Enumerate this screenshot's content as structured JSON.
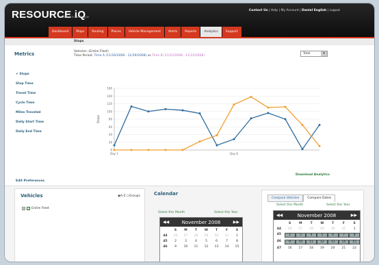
{
  "brand": {
    "logo": "RESOURCE iQ",
    "tagline": "CONNECTIONS BY jayte"
  },
  "toplinks": {
    "contact": "Contact Us",
    "help": "Help",
    "account": "My Account",
    "user": "Daniel English",
    "logout": "Logout"
  },
  "nav": [
    "Dashboard",
    "Maps",
    "Routing",
    "Places",
    "Vehicle Management",
    "Alerts",
    "Reports",
    "Analytics",
    "Support"
  ],
  "nav_active": "Analytics",
  "section_title": "Stops",
  "metrics": {
    "title": "Metrics",
    "items": [
      "+ Stops",
      "Stop Time",
      "Travel Time",
      "Cycle Time",
      "Miles Traveled",
      "Daily Start Time",
      "Daily End Time"
    ]
  },
  "vehicles_line": "Vehicles: (Entire Fleet)",
  "period": {
    "label": "Time Period:",
    "a": "Time A (11/16/2008 - 11/29/2008)",
    "sep": "vs",
    "b": "Time B (11/15/2008 - 11/15/2008)"
  },
  "select": {
    "value": "Total"
  },
  "chart_data": {
    "type": "line",
    "x": [
      1,
      2,
      3,
      4,
      5,
      6,
      7,
      8,
      9,
      10,
      11,
      12,
      13,
      14
    ],
    "xtick_labels": {
      "1": "Day 1",
      "8": "Day 8"
    },
    "ylabel": "Stops",
    "ylim": [
      0,
      160
    ],
    "yticks": [
      0,
      20,
      40,
      60,
      80,
      100,
      120,
      140,
      160
    ],
    "grid": true,
    "series": [
      {
        "color": "#2b6aa0",
        "values": [
          12,
          113,
          100,
          106,
          103,
          95,
          12,
          28,
          82,
          96,
          80,
          2,
          65
        ]
      },
      {
        "color": "#f0a030",
        "values": [
          0,
          0,
          0,
          0,
          0,
          22,
          38,
          118,
          138,
          110,
          112,
          65,
          10
        ]
      }
    ]
  },
  "download_label": "Download Analytics",
  "edit_prefs": "Edit Preferences",
  "vehicles_panel": {
    "title": "Vehicles",
    "sort_az": "A-Z",
    "sort_groups": "Groups",
    "tree_item": "Entire Fleet"
  },
  "calendar": {
    "title": "Calendar",
    "select_month": "Select this Month",
    "select_year": "Select this Year",
    "month": "November 2008",
    "day_headers": [
      "",
      "S",
      "M",
      "T",
      "W",
      "T",
      "F",
      "S"
    ],
    "rows_left": [
      [
        "44",
        "26",
        "27",
        "28",
        "29",
        "30",
        "31",
        "1"
      ],
      [
        "45",
        "2",
        "3",
        "4",
        "5",
        "6",
        "7",
        "8"
      ],
      [
        "46",
        "9",
        "10",
        "11",
        "12",
        "13",
        "14",
        "15"
      ]
    ],
    "rows_right": [
      [
        "44",
        "26",
        "27",
        "28",
        "29",
        "30",
        "31",
        "1"
      ],
      [
        "45",
        "2",
        "3",
        "4",
        "5",
        "6",
        "7",
        "8"
      ],
      [
        "46",
        "9",
        "10",
        "11",
        "12",
        "13",
        "14",
        "15"
      ],
      [
        "47",
        "16",
        "17",
        "18",
        "19",
        "20",
        "21",
        "22"
      ]
    ]
  },
  "compare_tabs": [
    "Compare Vehicles",
    "Compare Dates"
  ],
  "compare_active": "Compare Dates"
}
